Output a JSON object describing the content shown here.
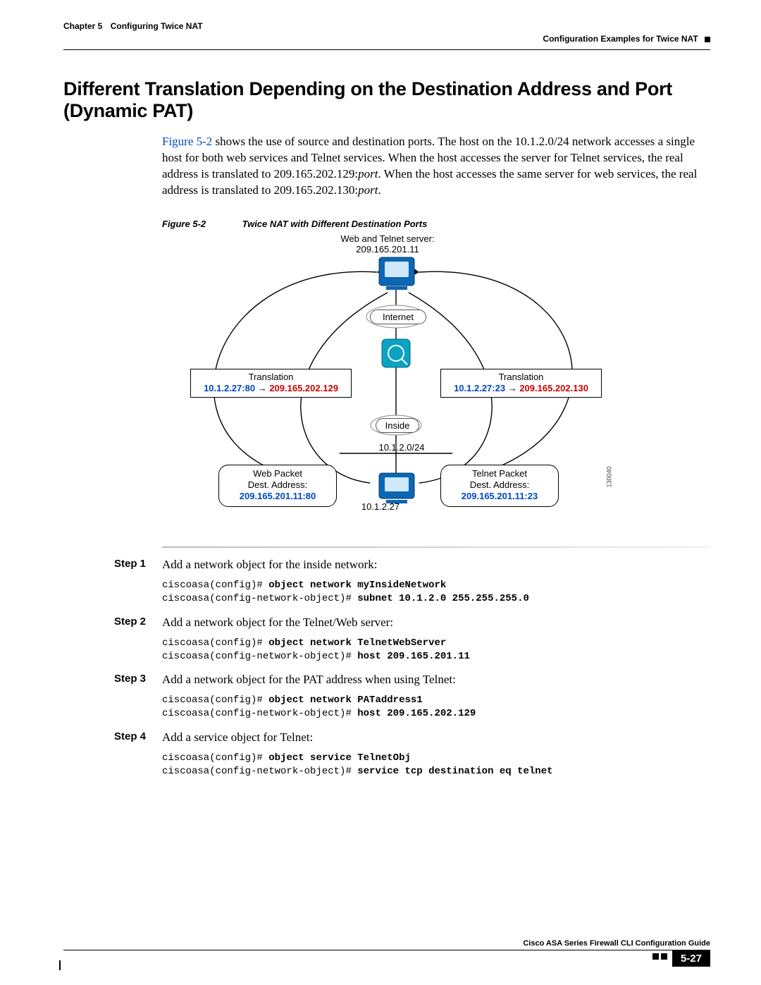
{
  "header": {
    "chapter_lbl": "Chapter 5",
    "chapter_title": "Configuring Twice NAT",
    "section_path": "Configuration Examples for Twice NAT"
  },
  "title": "Different Translation Depending on the Destination Address and Port (Dynamic PAT)",
  "intro": {
    "fig_ref": "Figure 5-2",
    "text_after_ref": " shows the use of source and destination ports. The host on the 10.1.2.0/24 network accesses a single host for both web services and Telnet services. When the host accesses the server for Telnet services, the real address is translated to 209.165.202.129:",
    "port1_suffix": ". When the host accesses the same server for web services, the real address is translated to 209.165.202.130:",
    "port_word": "port",
    "tail": "."
  },
  "figure": {
    "label": "Figure 5-2",
    "title": "Twice NAT with Different Destination Ports",
    "server_label1": "Web and Telnet server:",
    "server_ip": "209.165.201.11",
    "internet": "Internet",
    "inside": "Inside",
    "subnet": "10.1.2.0/24",
    "host": "10.1.2.27",
    "left": {
      "trans_title": "Translation",
      "src": "10.1.2.27:80",
      "dst": "209.165.202.129",
      "packet_title": "Web Packet",
      "dest_label": "Dest. Address:",
      "addr": "209.165.201.11:80"
    },
    "right": {
      "trans_title": "Translation",
      "src": "10.1.2.27:23",
      "dst": "209.165.202.130",
      "packet_title": "Telnet Packet",
      "dest_label": "Dest. Address:",
      "addr": "209.165.201.11:23"
    },
    "side_id": "130040"
  },
  "steps": [
    {
      "label": "Step 1",
      "desc": "Add a network object for the inside network:",
      "code": [
        {
          "pre": "ciscoasa(config)# ",
          "bold": "object network myInsideNetwork"
        },
        {
          "pre": "ciscoasa(config-network-object)# ",
          "bold": "subnet 10.1.2.0 255.255.255.0"
        }
      ]
    },
    {
      "label": "Step 2",
      "desc": "Add a network object for the Telnet/Web server:",
      "code": [
        {
          "pre": "ciscoasa(config)# ",
          "bold": "object network TelnetWebServer"
        },
        {
          "pre": "ciscoasa(config-network-object)# ",
          "bold": "host 209.165.201.11"
        }
      ]
    },
    {
      "label": "Step 3",
      "desc": "Add a network object for the PAT address when using Telnet:",
      "code": [
        {
          "pre": "ciscoasa(config)# ",
          "bold": "object network PATaddress1"
        },
        {
          "pre": "ciscoasa(config-network-object)# ",
          "bold": "host 209.165.202.129"
        }
      ]
    },
    {
      "label": "Step 4",
      "desc": "Add a service object for Telnet:",
      "code": [
        {
          "pre": "ciscoasa(config)# ",
          "bold": "object service TelnetObj"
        },
        {
          "pre": "ciscoasa(config-network-object)# ",
          "bold": "service tcp destination eq telnet"
        }
      ]
    }
  ],
  "footer": {
    "book": "Cisco ASA Series Firewall CLI Configuration Guide",
    "page": "5-27"
  }
}
